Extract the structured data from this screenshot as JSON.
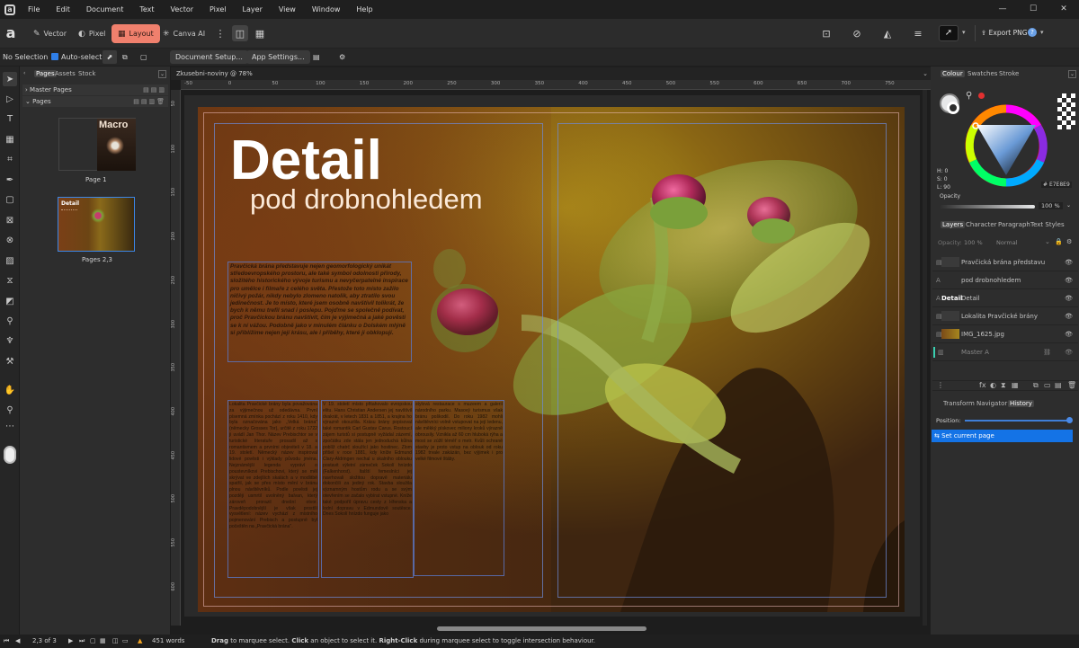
{
  "menu": {
    "items": [
      "File",
      "Edit",
      "Document",
      "Text",
      "Vector",
      "Pixel",
      "Layer",
      "View",
      "Window",
      "Help"
    ]
  },
  "window_controls": {
    "minimize": "—",
    "maximize": "☐",
    "close": "✕"
  },
  "personas": {
    "vector": "Vector",
    "pixel": "Pixel",
    "layout": "Layout",
    "canva": "Canva AI"
  },
  "export": {
    "label": "Export PNG"
  },
  "context": {
    "selection": "No Selection",
    "autoselect": "Auto-select:",
    "document_setup": "Document Setup...",
    "app_settings": "App Settings..."
  },
  "pages_panel": {
    "tabs": [
      "Pages",
      "Assets",
      "Stock"
    ],
    "master_pages": "Master Pages",
    "pages": "Pages",
    "page1_label": "Page 1",
    "page1_thumb_title": "Macro",
    "page23_label": "Pages 2,3",
    "page23_thumb_title": "Detail"
  },
  "document": {
    "tab_title": "Zkusebni-noviny @ 78%"
  },
  "ruler": {
    "top": [
      "-50",
      "0",
      "50",
      "100",
      "150",
      "200",
      "250",
      "300",
      "350",
      "400",
      "450",
      "500",
      "550",
      "600",
      "650",
      "700",
      "750"
    ],
    "left": [
      "50",
      "100",
      "150",
      "200",
      "250",
      "300",
      "350",
      "400",
      "450",
      "500",
      "550",
      "600"
    ]
  },
  "article": {
    "headline": "Detail",
    "subheadline": "pod drobnohledem",
    "lead": "Pravčická brána představuje nejen geomorfologický unikát středoevropského prostoru, ale také symbol odolnosti přírody, složitého historického vývoje turismu a nevyčerpatelné inspirace pro umělce i filmaře z celého světa. Přestože toto místo zažilo ničivý požár, nikdy nebylo zlomeno natolik, aby ztratilo svou jedinečnost. Je to místo, které jsem osobně navštívil tolikrát, že bych k němu trefil snad i poslepu. Pojďme se společně podívat, proč Pravčickou bránu navštívit, čím je výjimečná a jaké pověsti se k ní vážou. Podobně jako v minulém článku o Dolském mlýně si přiblížíme nejen její krásu, ale i příběhy, které ji obklopují.",
    "col1": "Lokalita Pravčické brány byla považována za výjimečnou už odedávna. První písemná zmínka pochází z roku 1410, kdy byla označována jako „Velká brána\" (německy Grosses Tor), určitě z roku 1722 ji uvádí Jan Thor. Název Prebischtor se v turistické literatuře prosadil až s romantismem a prvními objeviteli v 18. a 19. století. Německý název inspiroval lidové pověsti i výklady původu jména. Nejznámější legenda vypráví o poustevníkovi Prebischovi, který se měl skrývat ve zdejších skalách a v modlitbě spatřil, jak se přes místo mění v bránu plnou návštěvníků. Podle pověsti jej později usmrtil uvolněný balvan, který zároveň prorazil dnešní otvor. Pravděpodobnější je však prostší vysvětlení: název vychází z místního pojmenování Prebisch a postupně byl počeštěn na „Pravčická brána\".",
    "col2": "V 19. století místo přitahovalo evropskou elitu. Hans Christian Andersen jej navštívil dvakrát, v letech 1831 a 1851, a krajina ho výrazně okouzlila. Krásu brány popisoval také romantik Carl Gustav Carus. Rostoucí zájem turistů si postupně vyžádal zázemí, zpočátku zde stála jen jednoduchá kůlna poblíž chatrč sloužící jako hostinec. Zlom přišel v roce 1881, kdy kníže Edmund Clary-Aldringen nechal u skalního oblouku postavit výletní zámeček Sokolí hnízdo (Falkenhorst). Italští řemeslníci jej navrhovali složitou dopravě materiálu dokončili za jediný rok. Stavba sloužila významným hostům rodu a se svým otevřením se začalo vybírat vstupné. Kníže také podpořil úpravu cesty z Hřenska a lodní dopravu v Edmundově soutěsce. Dnes Sokolí hnízdo funguje jako",
    "col3": "stylová restaurace s muzeem a galerií národního parku. Masový turismus však bránu poškodil. Do roku 1982 mohli návštěvníci volně vstupovat na její ledenu, ale měkký pískovec miliony kroků výrazně obrousily. Vznikla až 60 cm hluboká rýha a most se zúžil téměř o metr. Kvůli ochraně stavby je proto vstup na oblouk od roku 1982 trvale zakázán, bez výjimek i pro velké filmové štáby."
  },
  "colour_panel": {
    "tabs": [
      "Colour",
      "Swatches",
      "Stroke"
    ],
    "h": "H: 0",
    "s": "S: 0",
    "l": "L: 90",
    "hex": "E7E8E9",
    "opacity_label": "Opacity",
    "opacity_value": "100 %"
  },
  "layers_panel": {
    "tabs": [
      "Layers",
      "Character",
      "Paragraph",
      "Text Styles"
    ],
    "opacity_label": "Opacity:",
    "opacity_value": "100 %",
    "blend": "Normal",
    "layers": [
      {
        "name": "Pravčická brána představu",
        "thumb": ""
      },
      {
        "name": "pod drobnohledem",
        "thumb": "A"
      },
      {
        "name": "Detail",
        "thumb": "Detail"
      },
      {
        "name": "Lokalita Pravčické brány",
        "thumb": ""
      },
      {
        "name": "IMG_1625.jpg",
        "thumb": ""
      },
      {
        "name": "Master A",
        "thumb": ""
      }
    ]
  },
  "history_panel": {
    "tabs": [
      "Transform",
      "Navigator",
      "History"
    ],
    "position_label": "Position:",
    "entry": "Set current page"
  },
  "status": {
    "page": "2,3 of 3",
    "words": "451 words",
    "hint_drag": "Drag",
    "hint_1": " to marquee select. ",
    "hint_click": "Click",
    "hint_2": " an object to select it. ",
    "hint_right": "Right-Click",
    "hint_3": " during marquee select to toggle intersection behaviour."
  },
  "colors": {
    "accent": "#f0806d",
    "selection": "#1473e6",
    "canvas": "#1d1d1d"
  }
}
